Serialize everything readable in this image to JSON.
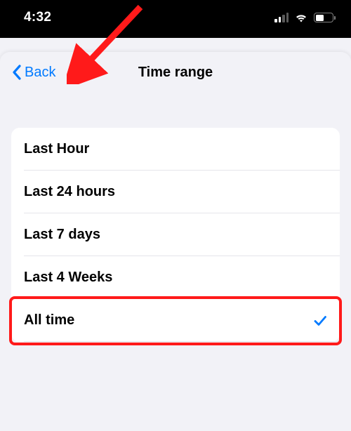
{
  "status": {
    "time": "4:32"
  },
  "nav": {
    "back_label": "Back",
    "title": "Time range"
  },
  "options": {
    "items": [
      {
        "label": "Last Hour",
        "selected": false
      },
      {
        "label": "Last 24 hours",
        "selected": false
      },
      {
        "label": "Last 7 days",
        "selected": false
      },
      {
        "label": "Last 4 Weeks",
        "selected": false
      },
      {
        "label": "All time",
        "selected": true
      }
    ]
  },
  "annotations": {
    "arrow_color": "#ff1a1a",
    "highlight_color": "#ff1a1a"
  }
}
